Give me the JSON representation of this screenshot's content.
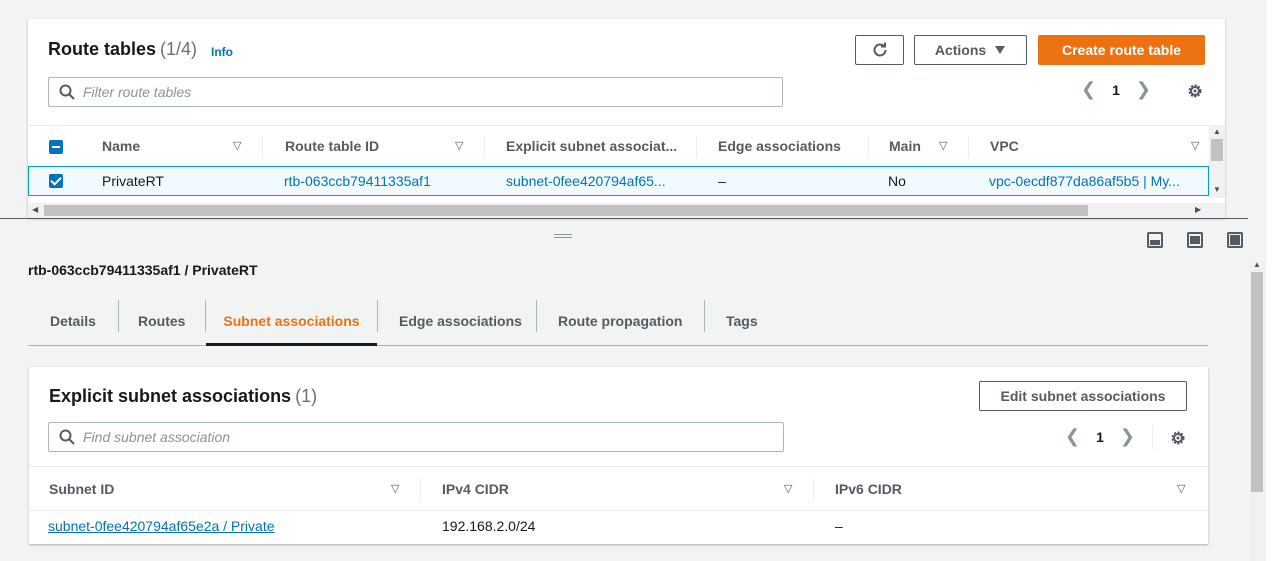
{
  "route_tables": {
    "title": "Route tables",
    "count": "(1/4)",
    "info_label": "Info",
    "actions_label": "Actions",
    "create_label": "Create route table",
    "filter_placeholder": "Filter route tables",
    "page": "1",
    "columns": [
      "Name",
      "Route table ID",
      "Explicit subnet associat...",
      "Edge associations",
      "Main",
      "VPC"
    ],
    "row": {
      "name": "PrivateRT",
      "route_table_id": "rtb-063ccb79411335af1",
      "explicit_subnet": "subnet-0fee420794af65...",
      "edge": "–",
      "main": "No",
      "vpc": "vpc-0ecdf877da86af5b5 | My..."
    }
  },
  "detail": {
    "title": "rtb-063ccb79411335af1 / PrivateRT",
    "tabs": [
      "Details",
      "Routes",
      "Subnet associations",
      "Edge associations",
      "Route propagation",
      "Tags"
    ],
    "active_tab": "Subnet associations"
  },
  "subnet_assoc": {
    "title": "Explicit subnet associations",
    "count": "(1)",
    "edit_label": "Edit subnet associations",
    "filter_placeholder": "Find subnet association",
    "page": "1",
    "columns": [
      "Subnet ID",
      "IPv4 CIDR",
      "IPv6 CIDR"
    ],
    "row": {
      "subnet_id": "subnet-0fee420794af65e2a / Private",
      "ipv4": "192.168.2.0/24",
      "ipv6": "–"
    }
  },
  "colors": {
    "primary": "#ec7211",
    "link": "#0073bb",
    "selected_row": "#f1faff"
  }
}
